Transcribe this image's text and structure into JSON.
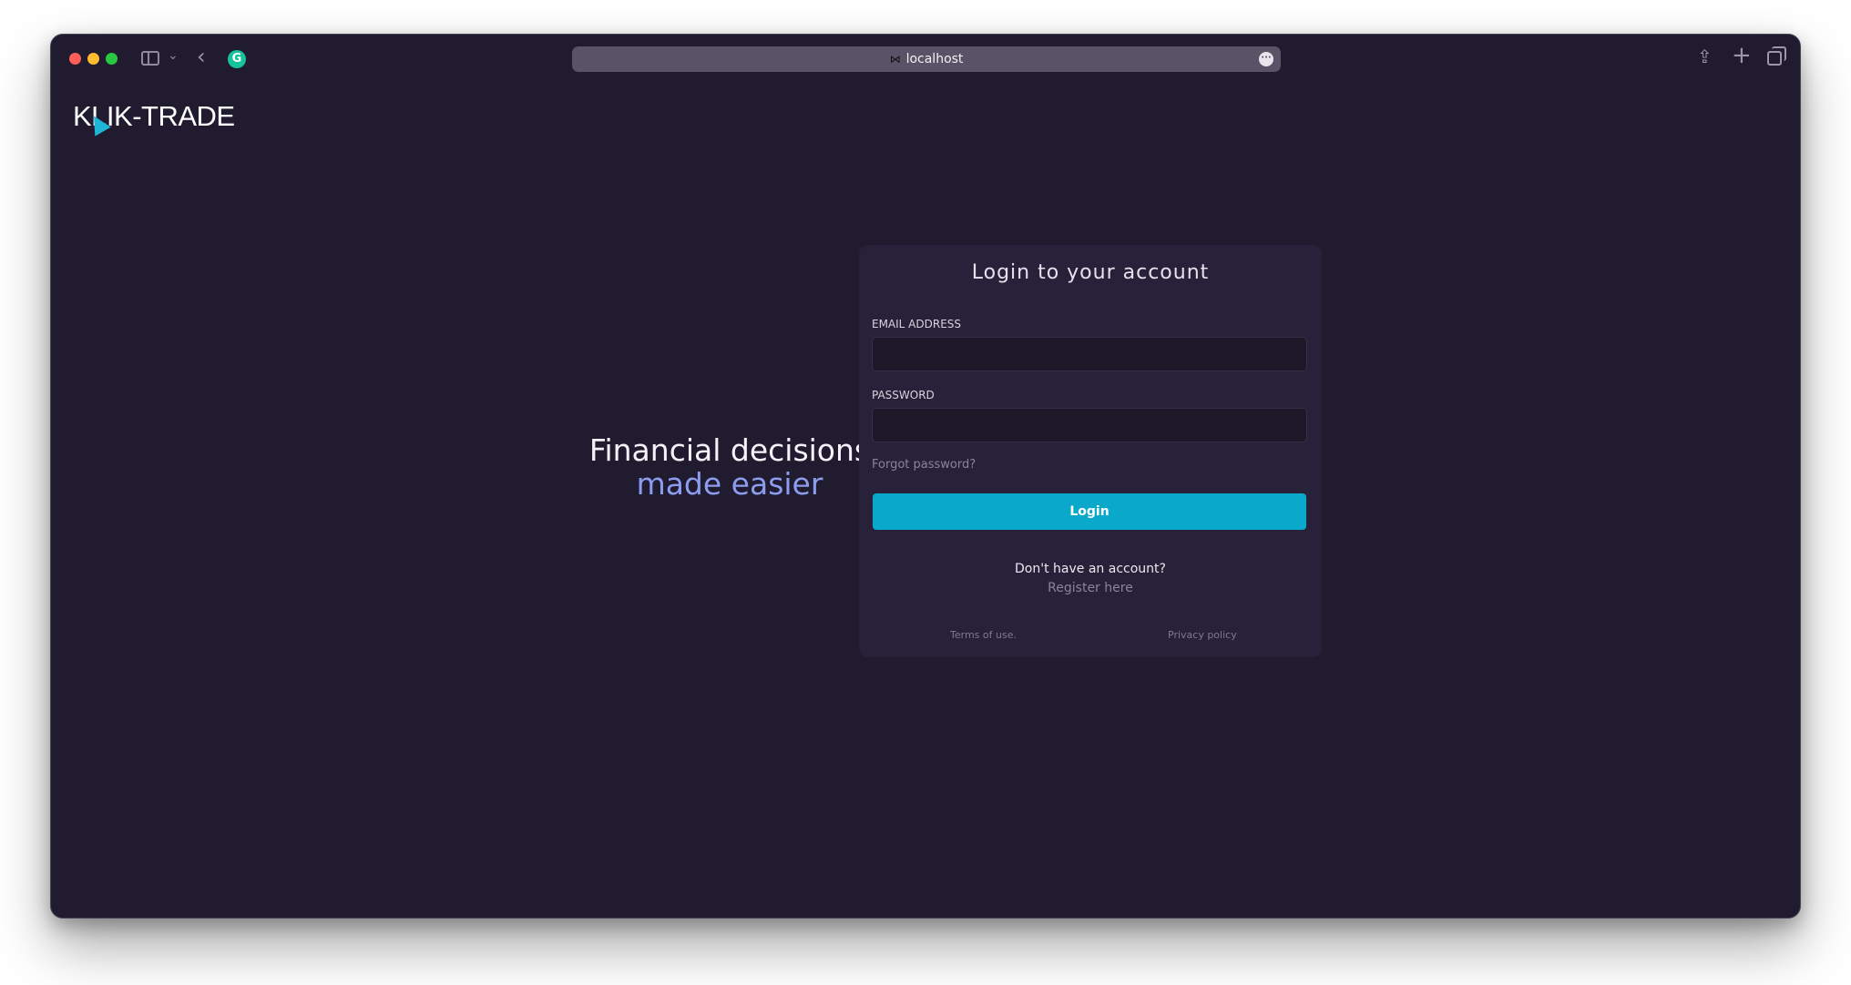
{
  "browser": {
    "url": "localhost",
    "favicon": "bow-tie-icon",
    "icons": [
      "sidebar-toggle-icon",
      "chevron-down-icon",
      "back-icon",
      "grammarly-icon",
      "more-icon",
      "share-icon",
      "plus-icon",
      "tabs-overview-icon"
    ]
  },
  "brand": {
    "logo_text": "KLIK-TRADE",
    "accent": "#0aa9cc"
  },
  "tagline": {
    "line1": "Financial decisions",
    "line2": "made easier",
    "line2_color": "#8c9df0"
  },
  "login": {
    "title": "Login to your account",
    "email_label": "EMAIL ADDRESS",
    "email_value": "",
    "password_label": "PASSWORD",
    "password_value": "",
    "forgot": "Forgot password?",
    "submit": "Login",
    "no_account": "Don't have an account?",
    "register": "Register here",
    "terms": "Terms of use.",
    "privacy": "Privacy policy"
  }
}
